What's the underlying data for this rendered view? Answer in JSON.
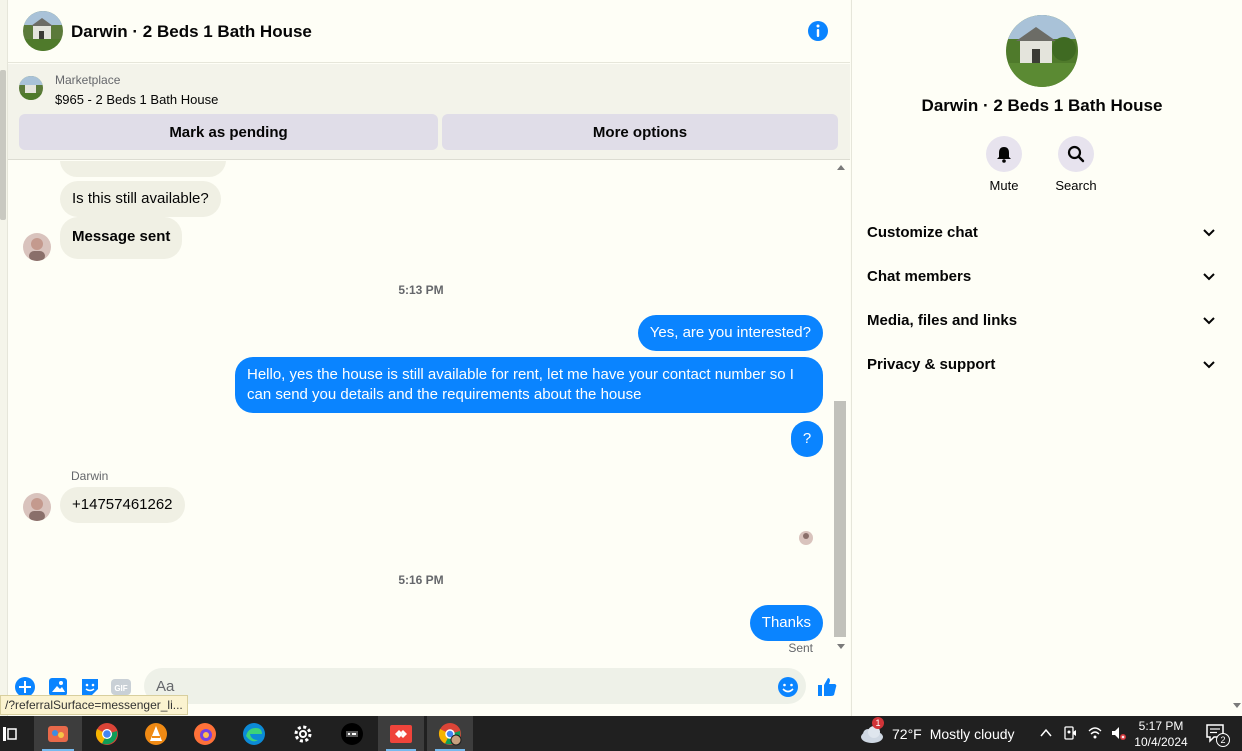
{
  "chat": {
    "title": "Darwin · 2 Beds 1 Bath House",
    "marketplace_label": "Marketplace",
    "listing_price_title": "$965 - 2 Beds 1 Bath House",
    "mark_pending_label": "Mark as pending",
    "more_options_label": "More options"
  },
  "messages": {
    "incoming_1": "Is this still available?",
    "incoming_2": "Message sent",
    "time_1": "5:13 PM",
    "outgoing_1": "Yes, are you interested?",
    "outgoing_2": "Hello, yes the house is still available for rent, let me have your contact number so I can send you details and the requirements about the house",
    "outgoing_3": "?",
    "sender_name": "Darwin",
    "incoming_3": "+14757461262",
    "time_2": "5:16 PM",
    "outgoing_4": "Thanks",
    "sent_status": "Sent"
  },
  "composer": {
    "placeholder": "Aa",
    "link_preview": "/?referralSurface=messenger_li..."
  },
  "panel": {
    "name": "Darwin · 2 Beds 1 Bath House",
    "mute_label": "Mute",
    "search_label": "Search",
    "sections": [
      "Customize chat",
      "Chat members",
      "Media, files and links",
      "Privacy & support"
    ]
  },
  "taskbar": {
    "weather_temp": "72°F",
    "weather_desc": "Mostly cloudy",
    "weather_badge": "1",
    "time": "5:17 PM",
    "date": "10/4/2024",
    "notification_count": "2"
  },
  "colors": {
    "accent": "#0a84ff",
    "background": "#fefef6",
    "taskbar": "#202020"
  }
}
